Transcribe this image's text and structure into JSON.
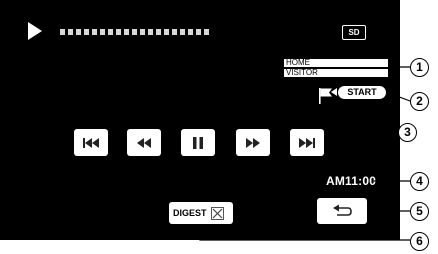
{
  "status": {
    "play_icon": "play-icon",
    "media_badge": "SD"
  },
  "scoreboard": {
    "home_label": "HOME",
    "visitor_label": "VISITOR"
  },
  "markers": {
    "start_label": "START",
    "flag_icon": "flag-icon"
  },
  "controls": [
    {
      "name": "skip-previous-button",
      "icon": "skip-previous-icon"
    },
    {
      "name": "rewind-button",
      "icon": "rewind-icon"
    },
    {
      "name": "pause-button",
      "icon": "pause-icon"
    },
    {
      "name": "fast-forward-button",
      "icon": "fast-forward-icon"
    },
    {
      "name": "skip-next-button",
      "icon": "skip-next-icon"
    }
  ],
  "clock": {
    "time": "AM11:00"
  },
  "digest": {
    "label": "DIGEST"
  },
  "back": {
    "icon": "return-arrow-icon"
  },
  "callouts": [
    "1",
    "2",
    "3",
    "4",
    "5",
    "6"
  ],
  "colors": {
    "screen_bg": "#000000",
    "button_bg": "#ffffff",
    "text_light": "#ffffff"
  }
}
